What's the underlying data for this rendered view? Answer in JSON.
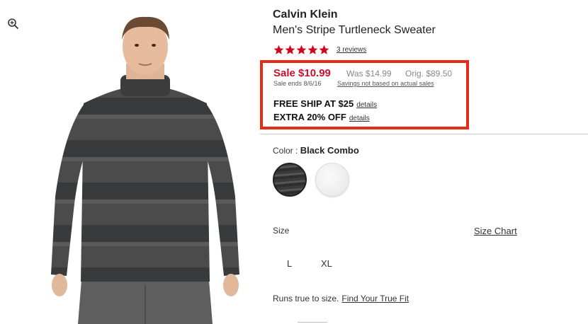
{
  "product": {
    "brand": "Calvin Klein",
    "title": "Men's Stripe Turtleneck Sweater",
    "rating": 5,
    "reviews_link": "3 reviews"
  },
  "pricing": {
    "sale": "Sale $10.99",
    "was": "Was $14.99",
    "orig": "Orig. $89.50",
    "sale_ends": "Sale ends 8/6/16",
    "savings_note": "Savings not based on actual sales",
    "highlight_color": "#e52d16",
    "sale_color": "#c8102e"
  },
  "promos": [
    {
      "text": "FREE SHIP AT $25",
      "link": "details"
    },
    {
      "text": "EXTRA 20% OFF",
      "link": "details"
    }
  ],
  "color": {
    "label": "Color : ",
    "selected": "Black Combo",
    "swatches": [
      {
        "name": "Black Combo",
        "selected": true
      },
      {
        "name": "White",
        "selected": false
      }
    ]
  },
  "size": {
    "label": "Size",
    "chart_link": "Size Chart",
    "options": [
      "L",
      "XL"
    ]
  },
  "fit": {
    "text": "Runs true to size.",
    "link": "Find Your True Fit"
  },
  "icons": {
    "zoom": "zoom-in-icon",
    "star": "star-icon"
  }
}
